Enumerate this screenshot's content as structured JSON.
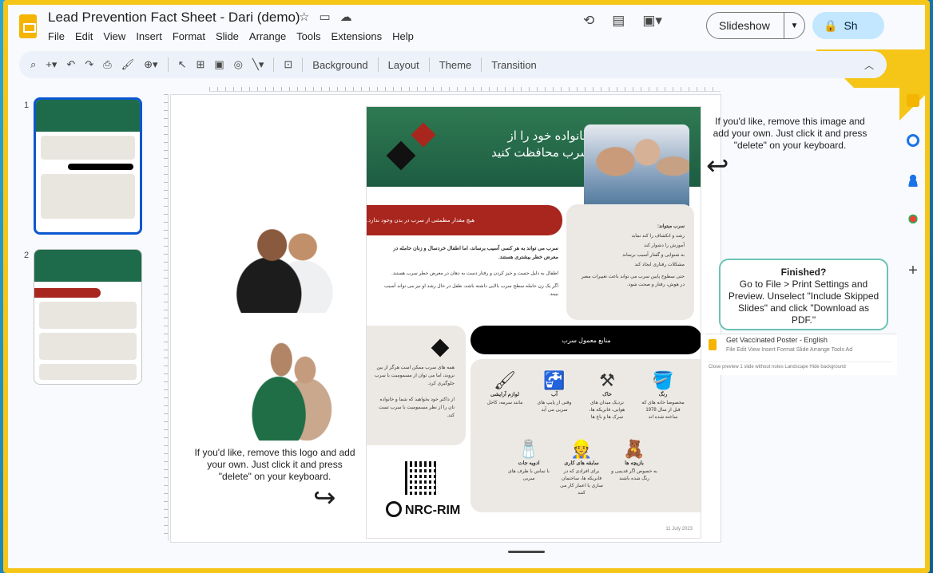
{
  "app": {
    "doc_title": "Lead Prevention Fact Sheet - Dari (demo)",
    "menu": [
      "File",
      "Edit",
      "View",
      "Insert",
      "Format",
      "Slide",
      "Arrange",
      "Tools",
      "Extensions",
      "Help"
    ],
    "slideshow_label": "Slideshow",
    "share_label": "Sh"
  },
  "toolbar": {
    "background_label": "Background",
    "layout_label": "Layout",
    "theme_label": "Theme",
    "transition_label": "Transition"
  },
  "thumbnails": [
    {
      "number": "1",
      "selected": true
    },
    {
      "number": "2",
      "selected": false
    }
  ],
  "poster": {
    "title": "خانواده خود را از سرب محافظت کنید",
    "red_banner": "هیچ مقدار مطمئنی از سرب در بدن وجود ندارد.",
    "left_bold": "سرب می تواند به هر کسی آسیب برساند، اما اطفال خردسال و زنان حامله در معرض خطر بیشتری هستند.",
    "left_bullets": [
      "اطفال به دلیل جست و خیز کردن و رفتار دست به دهان در معرض خطر سرب هستند.",
      "اگر یک زن حامله سطح سرب بالایی داشته باشد، طفل در حال رشد او نیز می تواند آسیب ببیند."
    ],
    "right_heading": "سرب میتواند:",
    "right_bullets": [
      "رشد و انکشاف را کند نماید",
      "آموزش را دشوار کند",
      "به شنوایی و گفتار آسیب برساند",
      "مشکلات رفتاری ایجاد کند"
    ],
    "right_paragraph": "حتی سطوح پایین سرب می تواند باعث تغییرات مضر در هوش، رفتار و صحت شود.",
    "sources_label": "منابع معمول سرب",
    "left_box_text": "همه های سرب ممکن است هرگز از بین نروند، اما می توان از مسمومیت با سرب جلوگیری کرد.",
    "left_box_text2": "از داکتر خود بخواهید که شما و خانواده تان را از نظر مسمومیت با سرب تست کند.",
    "sources": [
      {
        "title": "رنگ",
        "desc": "مخصوصا خانه های که قبل از سال 1978 ساخته شده اند",
        "icon": "paint-bucket-icon",
        "glyph": "🪣"
      },
      {
        "title": "خاک",
        "desc": "نزدیک میدان های هوایی، فابریکه ها، سرک ها و باغ ها",
        "icon": "shovel-icon",
        "glyph": "⚒"
      },
      {
        "title": "آب",
        "desc": "وقتی از پایپ های سربی می آید",
        "icon": "faucet-icon",
        "glyph": "🚰"
      },
      {
        "title": "لوازم آرایشی",
        "desc": "مانند سرمه، کاجل",
        "icon": "cosmetics-icon",
        "glyph": "🖌"
      },
      {
        "title": "بازیچه ها",
        "desc": "به خصوص اگر قدیمی و رنگ شده باشند",
        "icon": "toy-icon",
        "glyph": "🧸"
      },
      {
        "title": "سابقه های کاری",
        "desc": "برای افرادی که در فابریکه ها، ساختمان سازی یا اعمار کار می کنند",
        "icon": "worker-icon",
        "glyph": "👷"
      },
      {
        "title": "ادویه جات",
        "desc": "با تماس با ظرف های سربی",
        "icon": "spices-icon",
        "glyph": "🧂"
      }
    ],
    "logo_text": "NRC-RIM",
    "date": "11 July 2023"
  },
  "notes": {
    "top_right": "If you'd like, remove this image and add your own. Just click it and press \"delete\" on your keyboard.",
    "bottom_left": "If you'd like, remove this logo and add your own. Just click it and press \"delete\" on your keyboard.",
    "finished_title": "Finished?",
    "finished_body": "Go to File > Print Settings and Preview. Unselect \"Include Skipped Slides\" and click \"Download as PDF.\""
  },
  "mini_window": {
    "title": "Get Vaccinated Poster - English",
    "menu": "File Edit View Insert Format Slide Arrange Tools Ad",
    "toolbar": "Close preview    1 slide without notes    Landscape    Hide background"
  },
  "colors": {
    "accent_green": "#1e6b4c",
    "accent_red": "#a8261d",
    "frame_yellow": "#f5c518",
    "share_blue": "#c2e7ff"
  }
}
